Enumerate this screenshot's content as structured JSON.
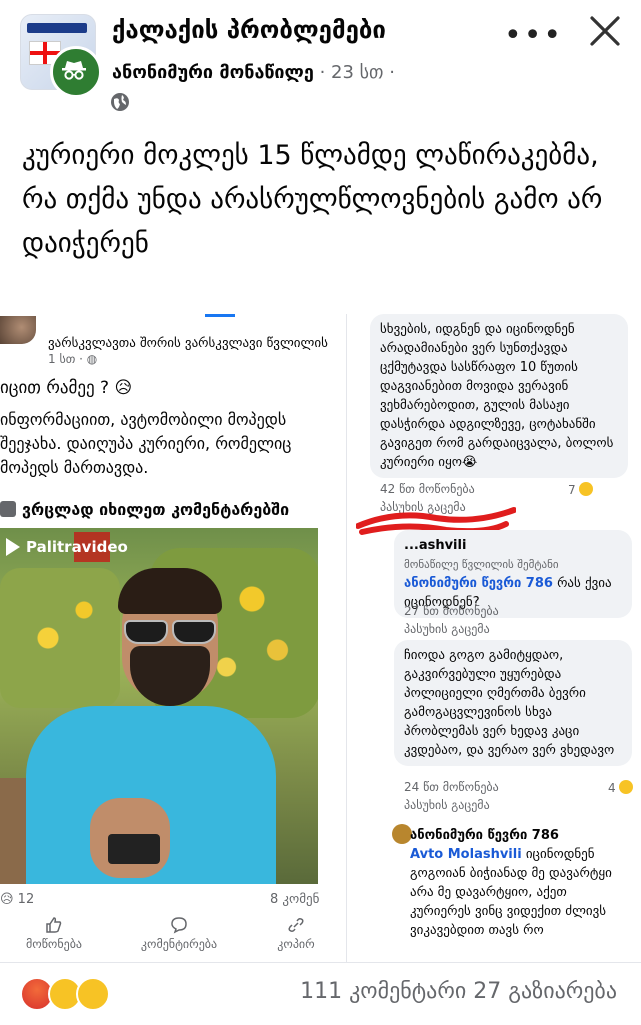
{
  "header": {
    "group_name": "ქალაქის პრობლემები",
    "author": "ანონიმური მონაწილე",
    "separator": " · ",
    "time": "23 სთ",
    "dot": " ·"
  },
  "post": {
    "text": "კურიერი მოკლეს 15 წლამდე ლაწირაკებმა, რა თქმა უნდა არასრულწლოვნების გამო არ დაიჭერენ"
  },
  "screenshot": {
    "left": {
      "author": "ვარსკვლავთა შორის ვარსკვლავი წვლილის",
      "time": "1 სთ · ",
      "question": "იცით რამეე ? 😥",
      "body": "ინფორმაციით, ავტომობილი მოპედს შეეჯახა. დაიღუპა კურიერი, რომელიც მოპედს მართავდა.",
      "see_more": "ვრცლად იხილეთ კომენტარებში",
      "logo": "Palitravideo",
      "reactions_count": "😥 12",
      "comments_count": "8 კომენ",
      "actions": [
        "მოწონება",
        "კომენტირება",
        "კოპირ"
      ]
    },
    "right": {
      "comment1": "სხვების, იდგნენ და იცინოდნენ არადამიანები ვერ სუნთქავდა ცქმუტავდა სასწრაფო 10 წუთის დაგვიანებით მოვიდა ვერავინ ვეხმარებოდით, გულის მასაჟი დასჭირდა ადგილზევე, ცოტახანში გავიგეთ რომ გარდაიცვალა, ბოლოს კურიერი იყო😭",
      "comment1_meta": "42 წთ    მოწონება",
      "comment1_reply": "პასუხის გაცემა",
      "comment1_react": "7",
      "comment2_name": "...ashvili",
      "comment2_badge": "მონაწილე წვლილის შემტანი",
      "comment2_mention": "ანონიმური წევრი 786",
      "comment2_text": " რას ქვია იცინოდნენ?",
      "comment2_meta": "27 წთ    მოწონება",
      "comment2_reply": "პასუხის გაცემა",
      "comment3_text": "ჩიოდა გოგო გამიტყდაო, გაკვირვებული უყურებდა პოლიციელი ღმერთმა ბევრი გამოგაცვლევინოს სხვა პრობლემას ვერ ხედავ კაცი კვდებაო, და ვერაო ვერ ვხედავო",
      "comment3_meta": "24 წთ    მოწონება",
      "comment3_reply": "პასუხის გაცემა",
      "comment3_react": "4",
      "comment4_name": "ანონიმური წევრი 786",
      "comment4_mention": "Avto Molashvili",
      "comment4_text": " იცინოდნენ გოგოიან ბიჭიანად მე დავარტყი არა მე დავარტყიო, აქეთ კურიერეს ვინც ვიდექით ძლივს ვიკავებდით თავს რო"
    }
  },
  "footer": {
    "comments": "111 კომენტარი",
    "shares": "27 გაზიარება"
  },
  "colors": {
    "accent_blue": "#1877f2",
    "badge_green": "#2f7d32",
    "meta_gray": "#65676b"
  },
  "icons": [
    "group-avatar",
    "anonymous-icon",
    "globe-icon",
    "more-icon",
    "close-icon",
    "like-icon",
    "comment-icon",
    "copy-icon",
    "angry-reaction-icon",
    "sad-reaction-icon",
    "wow-reaction-icon"
  ]
}
